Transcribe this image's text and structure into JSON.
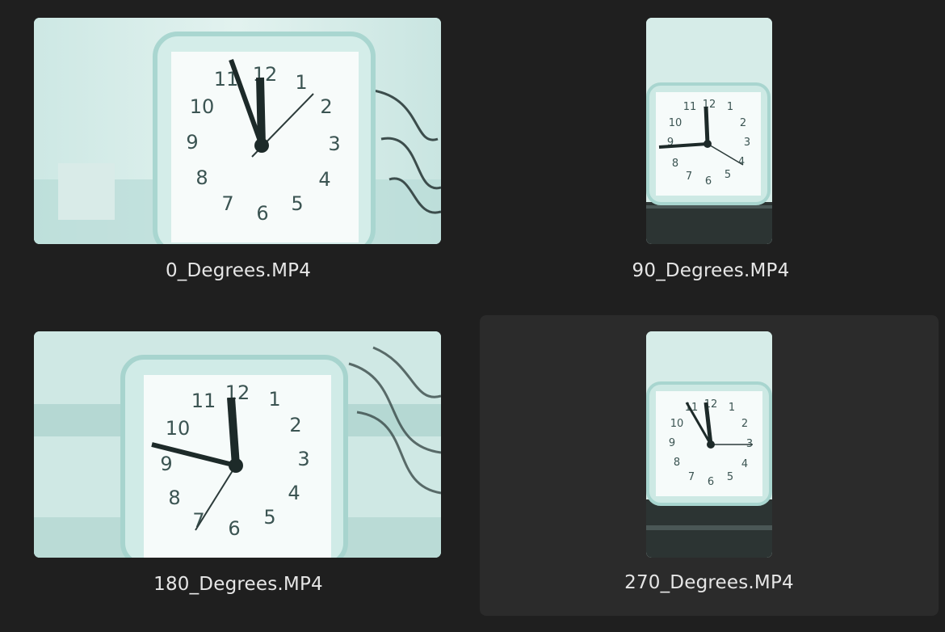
{
  "files": [
    {
      "name": "0_Degrees.MP4",
      "clock": {
        "hour": 11.9,
        "minute": 57,
        "second": 8
      }
    },
    {
      "name": "90_Degrees.MP4",
      "clock": {
        "hour": 11.95,
        "minute": 45,
        "second": 21
      }
    },
    {
      "name": "180_Degrees.MP4",
      "clock": {
        "hour": 11.95,
        "minute": 47,
        "second": 35
      }
    },
    {
      "name": "270_Degrees.MP4",
      "clock": {
        "hour": 11.95,
        "minute": 57,
        "second": 15
      }
    }
  ],
  "colors": {
    "background": "#1f1f1f",
    "selected_tile": "#2b2b2b",
    "caption": "#e6e6e6",
    "scene_tint": "#bfe3df"
  },
  "selection": "270_Degrees.MP4"
}
